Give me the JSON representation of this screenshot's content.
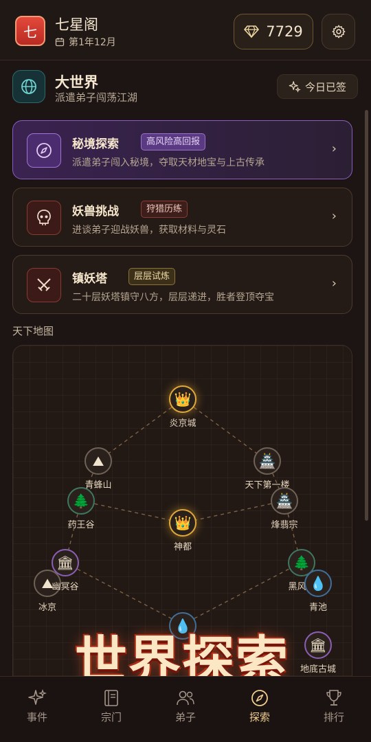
{
  "header": {
    "logo_char": "七",
    "sect_name": "七星阁",
    "date": "第1年12月",
    "gems": "7729"
  },
  "world": {
    "title": "大世界",
    "subtitle": "派遣弟子闯荡江湖",
    "signin_label": "今日已签"
  },
  "cards": [
    {
      "title": "秘境探索",
      "tag": "高风险高回报",
      "desc": "派遣弟子闯入秘境，夺取天材地宝与上古传承",
      "icon": "compass-icon"
    },
    {
      "title": "妖兽挑战",
      "tag": "狩猎历练",
      "desc": "进谈弟子迎战妖兽，获取材料与灵石",
      "icon": "skull-icon"
    },
    {
      "title": "镇妖塔",
      "tag": "层层试炼",
      "desc": "二十层妖塔镇守八方，层层递进，胜者登顶夺宝",
      "icon": "crossed-swords-icon"
    }
  ],
  "map": {
    "label": "天下地图",
    "nodes": [
      {
        "name": "炎京城",
        "icon": "crown-icon"
      },
      {
        "name": "青蜂山",
        "icon": "mountain-icon"
      },
      {
        "name": "天下第一楼",
        "icon": "palace-icon"
      },
      {
        "name": "药王谷",
        "icon": "tree-icon"
      },
      {
        "name": "神都",
        "icon": "crown-icon"
      },
      {
        "name": "烽翡宗",
        "icon": "palace-icon"
      },
      {
        "name": "冰京",
        "icon": "mountain-icon"
      },
      {
        "name": "幽冥谷",
        "icon": "temple-icon"
      },
      {
        "name": "黑风寨",
        "icon": "tree-icon"
      },
      {
        "name": "青池",
        "icon": "water-drop-icon"
      },
      {
        "name": "地底古城",
        "icon": "temple-icon"
      }
    ]
  },
  "banner": "世界探索",
  "tabs": [
    {
      "label": "事件",
      "icon": "sparkle-icon"
    },
    {
      "label": "宗门",
      "icon": "book-icon"
    },
    {
      "label": "弟子",
      "icon": "users-icon"
    },
    {
      "label": "探索",
      "icon": "compass-icon"
    },
    {
      "label": "排行",
      "icon": "trophy-icon"
    }
  ],
  "colors": {
    "accent_gold": "#f0ce8e",
    "purple_card": "#8a5ec0",
    "logo_red": "#d63a2e"
  }
}
